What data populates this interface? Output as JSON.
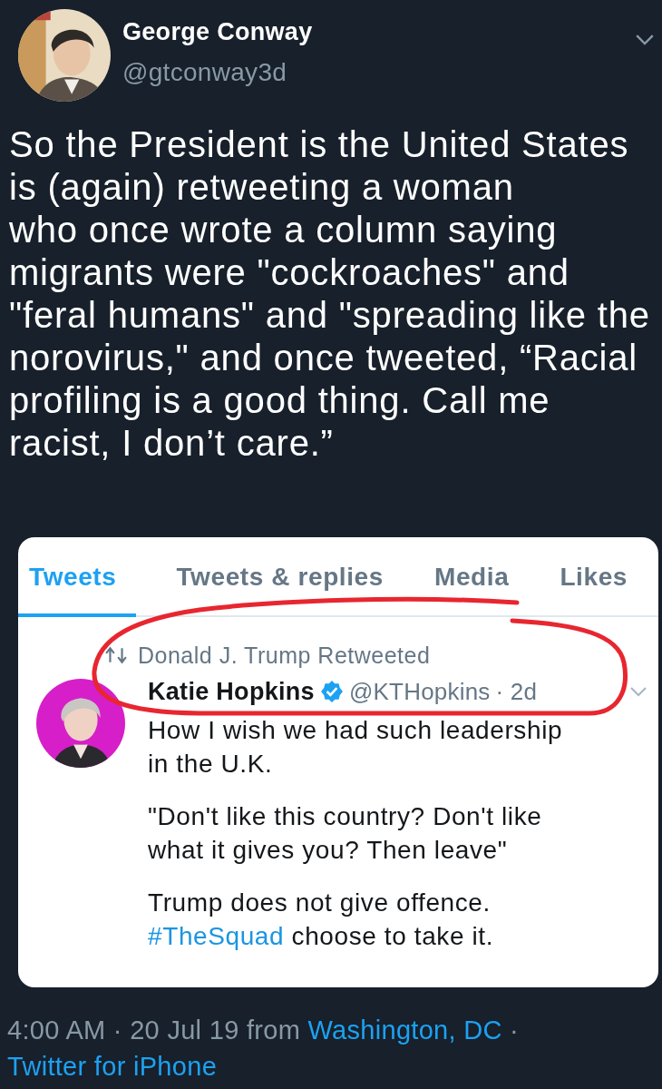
{
  "author": {
    "name": "George Conway",
    "handle": "@gtconway3d"
  },
  "body_lines": [
    "So the President is the United States",
    "is (again) retweeting a woman",
    "who once wrote a column saying",
    "migrants were \"cockroaches\" and",
    "\"feral humans\" and \"spreading like the",
    "norovirus,\" and once tweeted, “Racial",
    "profiling is a good thing. Call me",
    "racist, I don’t care.”"
  ],
  "embedded_screenshot": {
    "tabs": [
      {
        "label": "Tweets",
        "selected": true
      },
      {
        "label": "Tweets & replies",
        "selected": false
      },
      {
        "label": "Media",
        "selected": false
      },
      {
        "label": "Likes",
        "selected": false
      }
    ],
    "retweet_note": "Donald J. Trump Retweeted",
    "tweet": {
      "name": "Katie Hopkins",
      "verified": true,
      "handle": "@KTHopkins",
      "time": "· 2d",
      "paragraphs": [
        {
          "lines": [
            [
              {
                "kind": "plain",
                "text": "How I wish we had such leadership"
              }
            ],
            [
              {
                "kind": "plain",
                "text": "in the U.K."
              }
            ]
          ]
        },
        {
          "lines": [
            [
              {
                "kind": "plain",
                "text": "\"Don't like this country? Don't like"
              }
            ],
            [
              {
                "kind": "plain",
                "text": "what it gives you? Then leave\""
              }
            ]
          ]
        },
        {
          "lines": [
            [
              {
                "kind": "plain",
                "text": "Trump does not give offence."
              }
            ],
            [
              {
                "kind": "hashtag",
                "text": "#TheSquad"
              },
              {
                "kind": "plain",
                "text": " choose to take it."
              }
            ]
          ]
        }
      ]
    }
  },
  "footer": [
    {
      "kind": "plain",
      "text": "4:00 AM · 20 Jul 19 from "
    },
    {
      "kind": "link",
      "text": "Washington, DC"
    },
    {
      "kind": "plain",
      "text": " · "
    },
    {
      "kind": "link",
      "text": "Twitter for iPhone"
    }
  ]
}
